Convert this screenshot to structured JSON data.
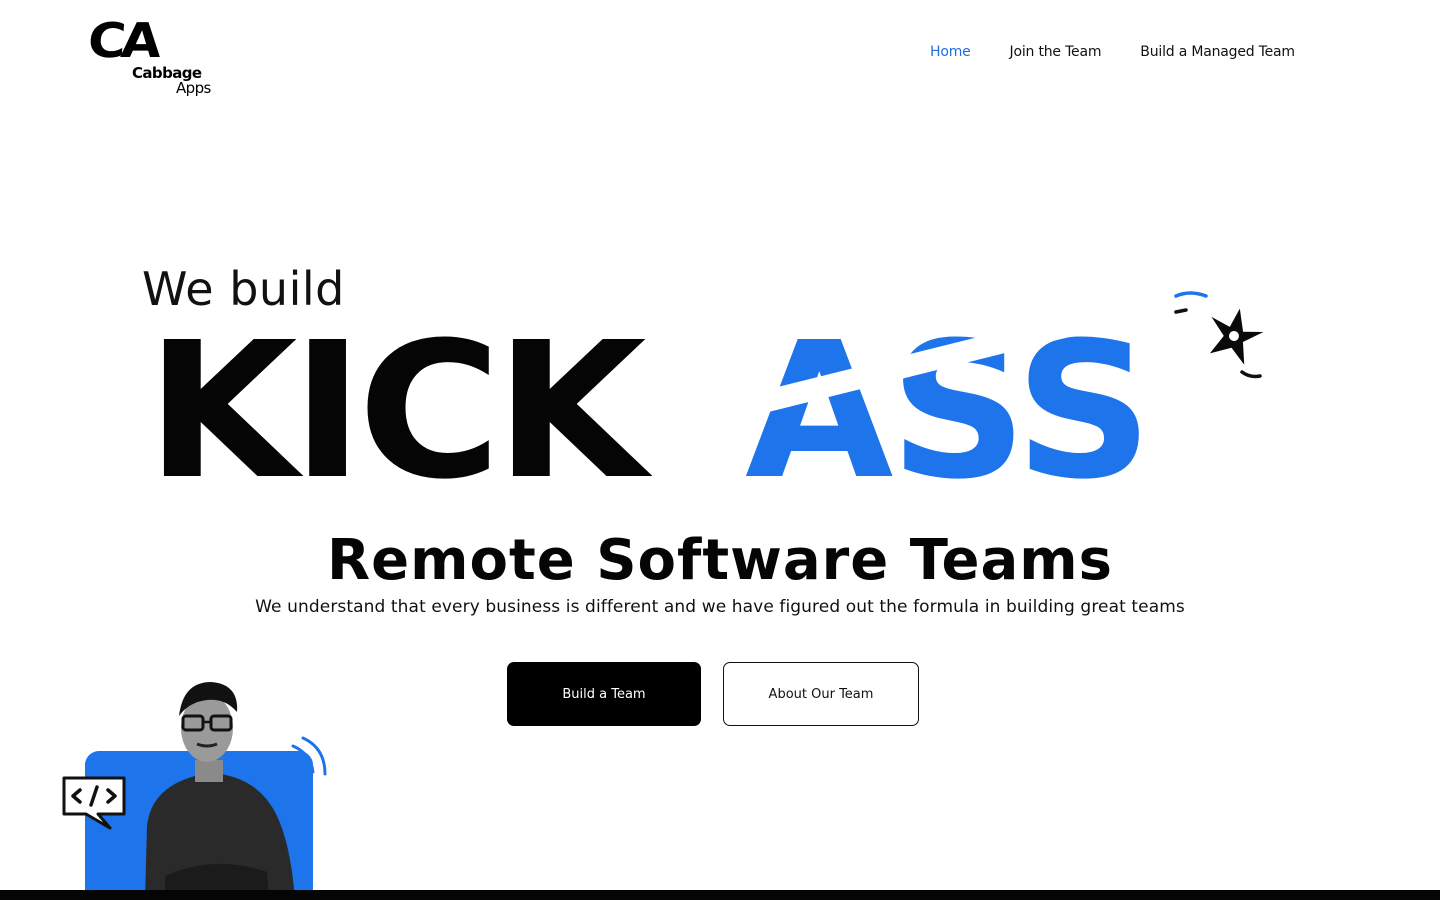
{
  "logo": {
    "mark": "CA",
    "line1": "Cabbage",
    "line2": "Apps"
  },
  "nav": {
    "items": [
      {
        "label": "Home",
        "active": true
      },
      {
        "label": "Join the Team",
        "active": false
      },
      {
        "label": "Build a Managed Team",
        "active": false
      }
    ]
  },
  "hero": {
    "intro": "We build",
    "headline_black": "KICK",
    "headline_blue": "ASS",
    "subheadline": "Remote Software Teams",
    "tagline": "We understand that every business is different and we have figured out the formula in building great teams"
  },
  "buttons": {
    "primary": "Build a Team",
    "secondary": "About Our Team"
  },
  "icons": {
    "shuriken": "shuriken-icon",
    "code": "code-bubble-icon"
  },
  "colors": {
    "accent": "#1e74ea",
    "nav_active": "#1e6fe6",
    "text": "#050505",
    "background": "#ffffff"
  }
}
